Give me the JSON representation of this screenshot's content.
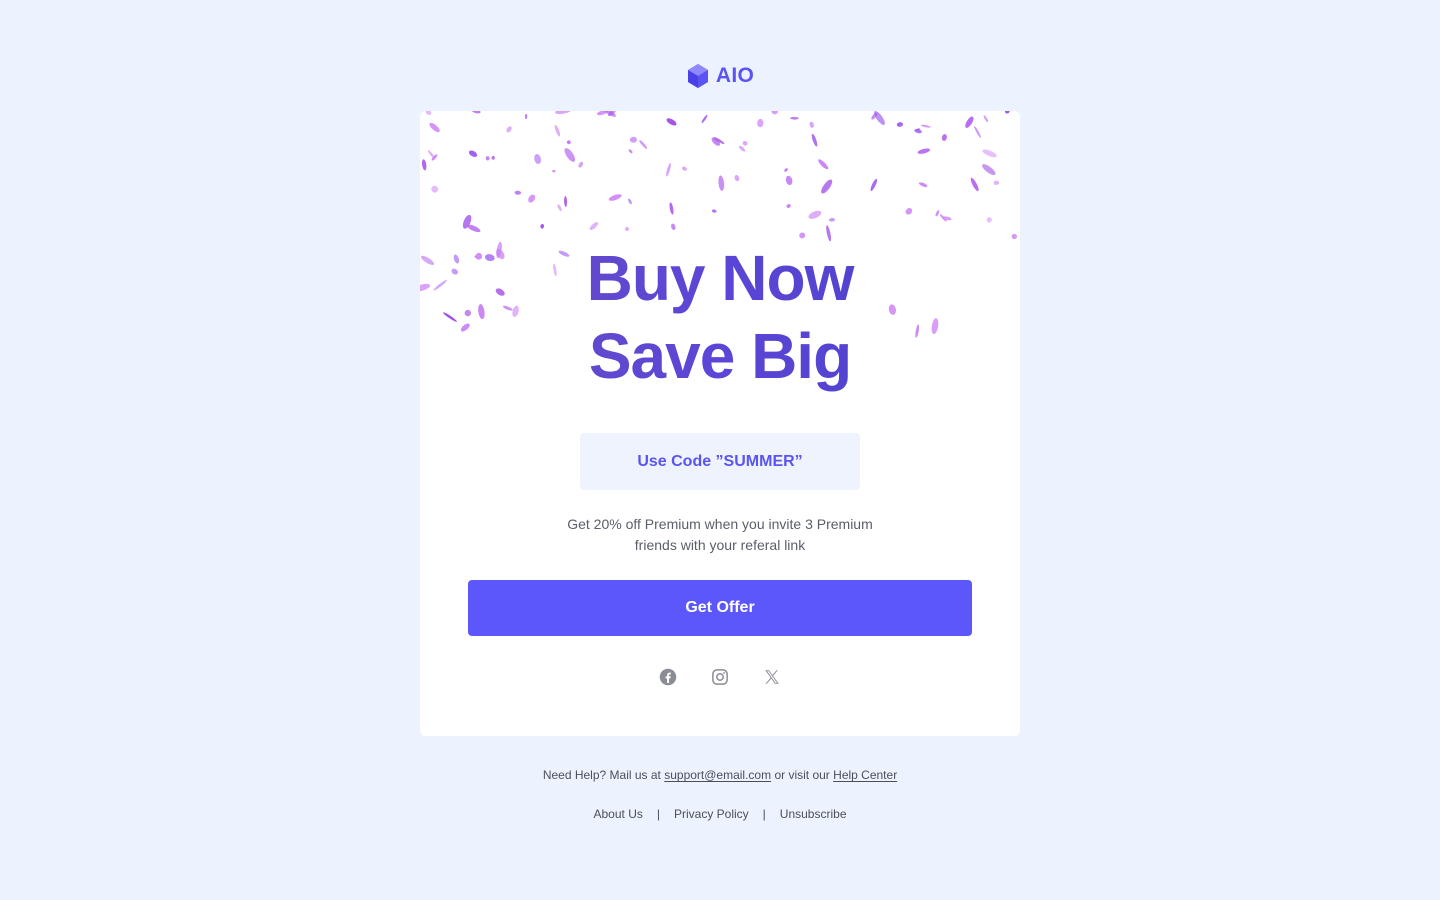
{
  "brand": {
    "name": "AIO",
    "color": "#5b54f5"
  },
  "hero": {
    "line1": "Buy Now",
    "line2": "Save Big",
    "color": "#5a45c8"
  },
  "promo": {
    "code_label": "Use Code ”SUMMER”"
  },
  "description": "Get 20% off Premium when you invite 3 Premium friends with your referal link",
  "cta": {
    "label": "Get Offer",
    "color": "#5b57fb"
  },
  "social": [
    {
      "icon": "facebook-icon"
    },
    {
      "icon": "instagram-icon"
    },
    {
      "icon": "x-icon"
    }
  ],
  "help": {
    "prefix": "Need Help? Mail us at",
    "email": "support@email.com",
    "middle": "or visit our",
    "help_center": "Help Center"
  },
  "footer": {
    "separator": "|",
    "links": [
      "About Us",
      "Privacy Policy",
      "Unsubscribe"
    ]
  },
  "colors": {
    "page_bg": "#edf3fe",
    "card_bg": "#ffffff",
    "confetti": "#b565f0"
  }
}
